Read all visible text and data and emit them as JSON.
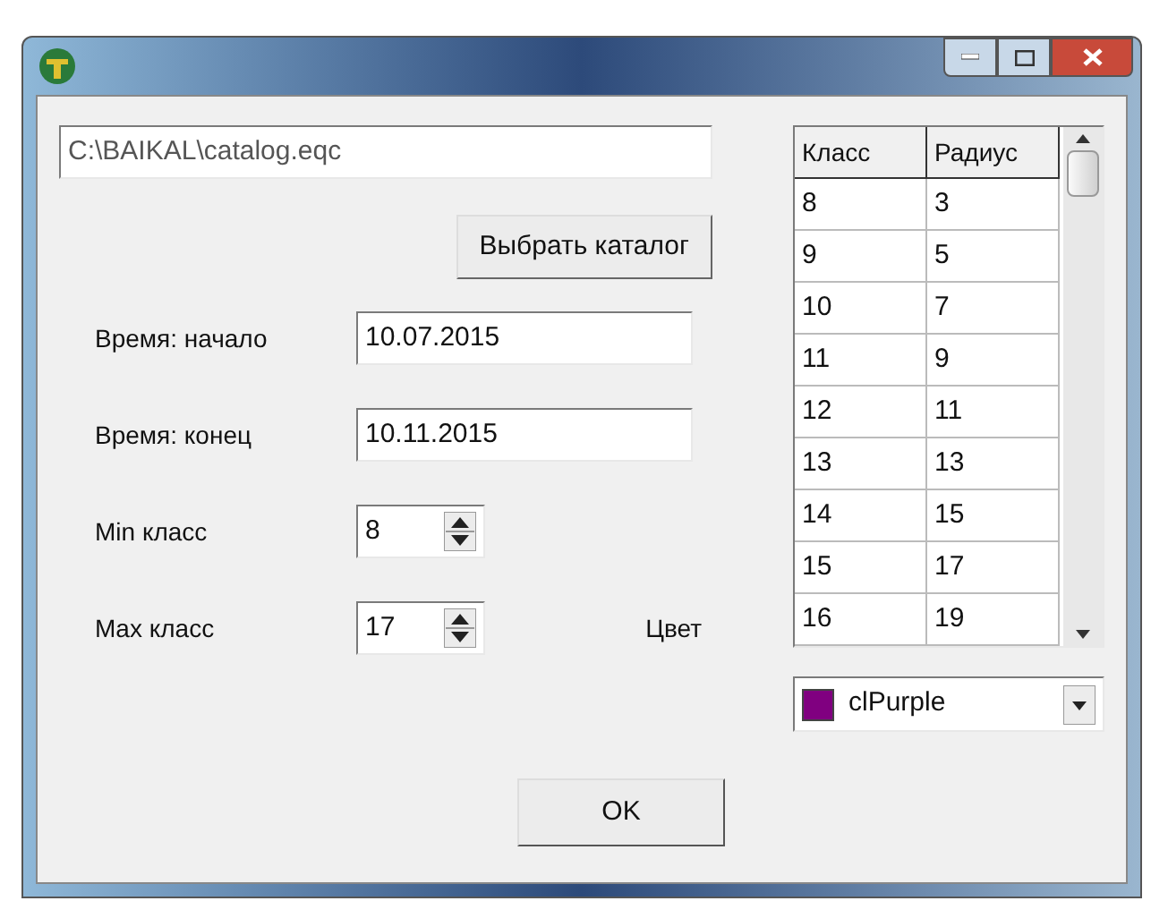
{
  "path_field": {
    "value": "C:\\BAIKAL\\catalog.eqc"
  },
  "choose_button": "Выбрать каталог",
  "fields": [
    {
      "kind": "text",
      "label": "Время: начало",
      "value": "10.07.2015"
    },
    {
      "kind": "text",
      "label": "Время: конец",
      "value": "10.11.2015"
    },
    {
      "kind": "spin",
      "label": "Min класс",
      "value": "8"
    },
    {
      "kind": "spin",
      "label": "Max класс",
      "value": "17"
    }
  ],
  "color_label": "Цвет",
  "table": {
    "columns": [
      "Класс",
      "Радиус"
    ],
    "rows": [
      [
        "8",
        "3"
      ],
      [
        "9",
        "5"
      ],
      [
        "10",
        "7"
      ],
      [
        "11",
        "9"
      ],
      [
        "12",
        "11"
      ],
      [
        "13",
        "13"
      ],
      [
        "14",
        "15"
      ],
      [
        "15",
        "17"
      ],
      [
        "16",
        "19"
      ]
    ]
  },
  "color_select": {
    "value": "clPurple",
    "color": "#800080"
  },
  "ok_button": "OK"
}
